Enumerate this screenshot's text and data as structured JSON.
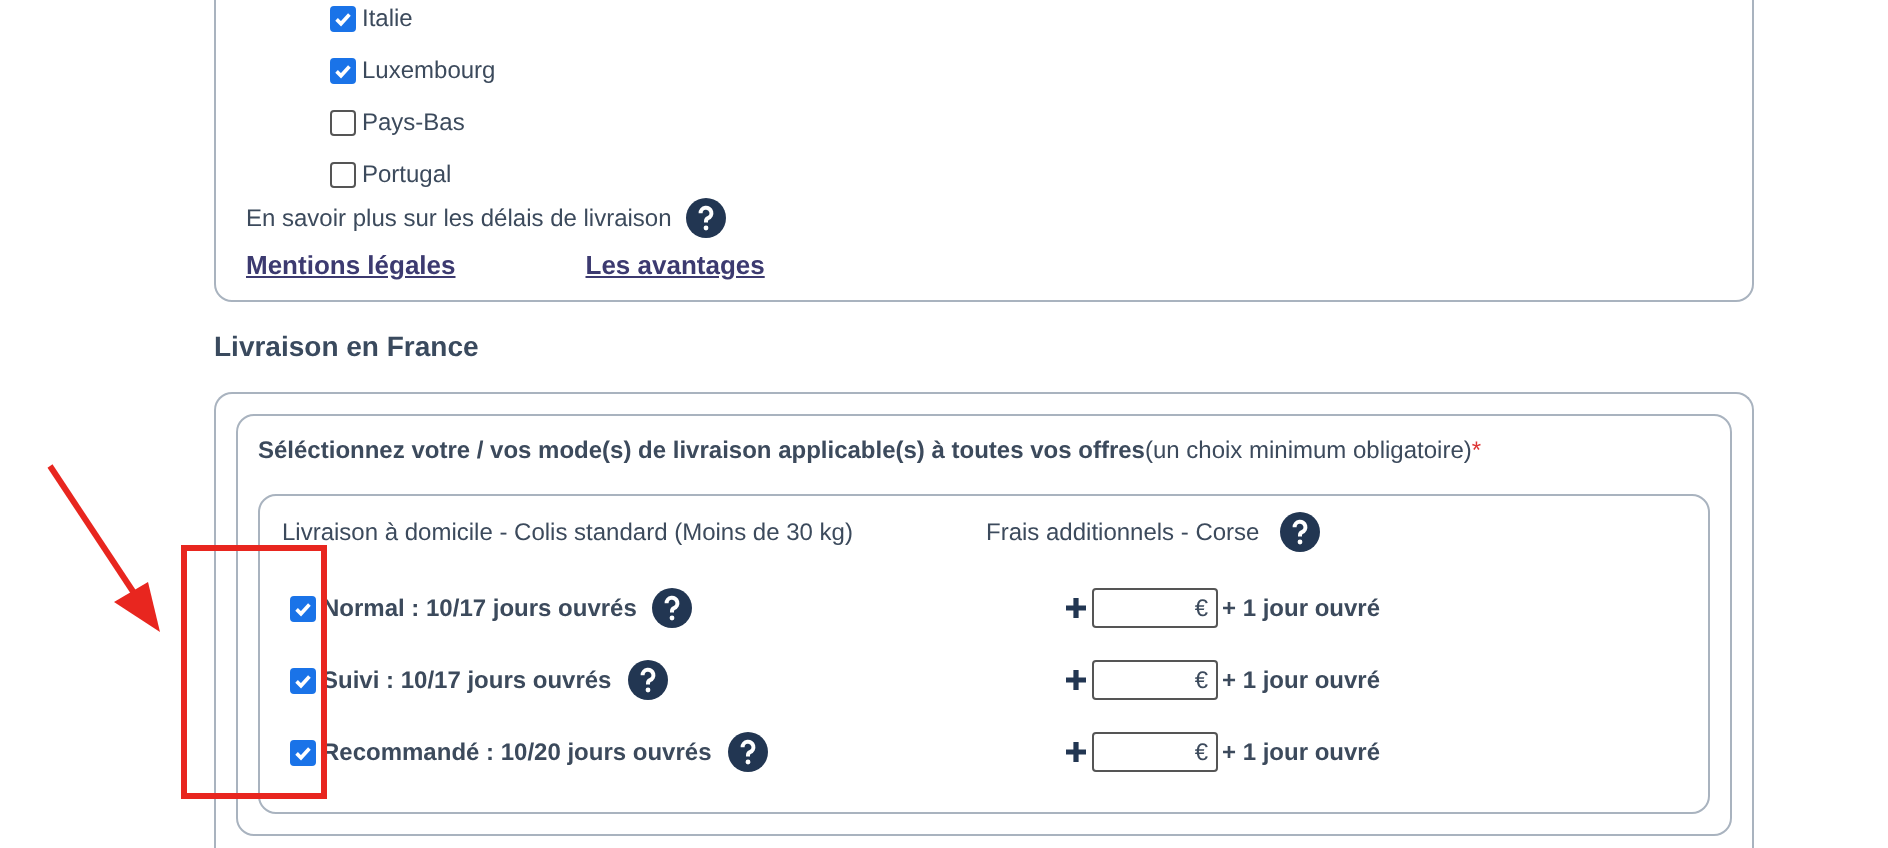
{
  "countries": [
    {
      "label": "Italie",
      "checked": true
    },
    {
      "label": "Luxembourg",
      "checked": true
    },
    {
      "label": "Pays-Bas",
      "checked": false
    },
    {
      "label": "Portugal",
      "checked": false
    }
  ],
  "info_text": "En savoir plus sur les délais de livraison",
  "links": [
    "Mentions légales",
    "Les avantages"
  ],
  "france": {
    "title": "Livraison en France",
    "instruction": "**Séléctionnez votre / vos mode(s) de livraison applicable(s) à toutes vos offres**(un choix minimum obligatoire)",
    "required_mark": "*",
    "group_label": "Livraison à domicile - Colis standard (Moins de 30 kg)",
    "fees_label": "Frais additionnels - Corse",
    "options": [
      {
        "label": "Normal : 10/17 jours ouvrés",
        "checked": true,
        "currency": "€",
        "extra": "+ 1 jour ouvré"
      },
      {
        "label": "Suivi : 10/17 jours ouvrés",
        "checked": true,
        "currency": "€",
        "extra": "+ 1 jour ouvré"
      },
      {
        "label": "Recommandé : 10/20 jours ouvrés",
        "checked": true,
        "currency": "€",
        "extra": "+ 1 jour ouvré"
      }
    ]
  }
}
